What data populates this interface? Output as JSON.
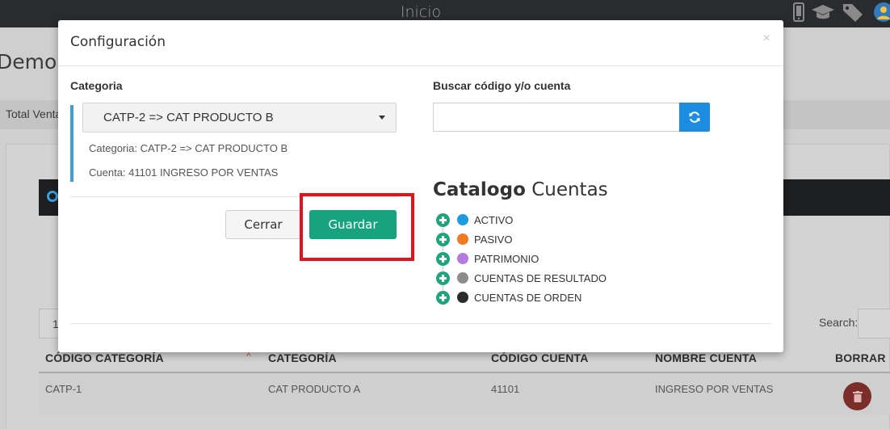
{
  "app": {
    "title": "Inicio"
  },
  "topbar_icons": [
    "mobile-icon",
    "graduation-cap-icon",
    "tags-icon",
    "user-avatar-icon"
  ],
  "background": {
    "heading": "Demo P",
    "tab_label": "Total Venta",
    "length_value": "1",
    "search_label": "Search:",
    "table": {
      "columns": [
        "CÓDIGO CATEGORÍA",
        "CATEGORÍA",
        "CÓDIGO CUENTA",
        "NOMBRE CUENTA",
        "BORRAR"
      ],
      "rows": [
        {
          "codigo_categoria": "CATP-1",
          "categoria": "CAT PRODUCTO A",
          "codigo_cuenta": "41101",
          "nombre_cuenta": "INGRESO POR VENTAS"
        }
      ]
    }
  },
  "modal": {
    "title": "Configuración",
    "close": "×",
    "categoria_label": "Categoria",
    "categoria_selected": "CATP-2 => CAT PRODUCTO B",
    "info_categoria": "Categoria: CATP-2 => CAT PRODUCTO B",
    "info_cuenta": "Cuenta: 41101 INGRESO POR VENTAS",
    "cerrar_label": "Cerrar",
    "guardar_label": "Guardar",
    "buscar_label": "Buscar código y/o cuenta",
    "buscar_value": "",
    "catalogo_title_bold": "Catalogo",
    "catalogo_title_light": "Cuentas",
    "tree": [
      {
        "label": "ACTIVO",
        "color": "#1b9ce0"
      },
      {
        "label": "PASIVO",
        "color": "#f07c22"
      },
      {
        "label": "PATRIMONIO",
        "color": "#b37be0"
      },
      {
        "label": "CUENTAS DE RESULTADO",
        "color": "#8c8c8c"
      },
      {
        "label": "CUENTAS DE ORDEN",
        "color": "#2b2b2b"
      }
    ],
    "highlight_color": "#e8101a",
    "accent_color": "#17a37f"
  }
}
